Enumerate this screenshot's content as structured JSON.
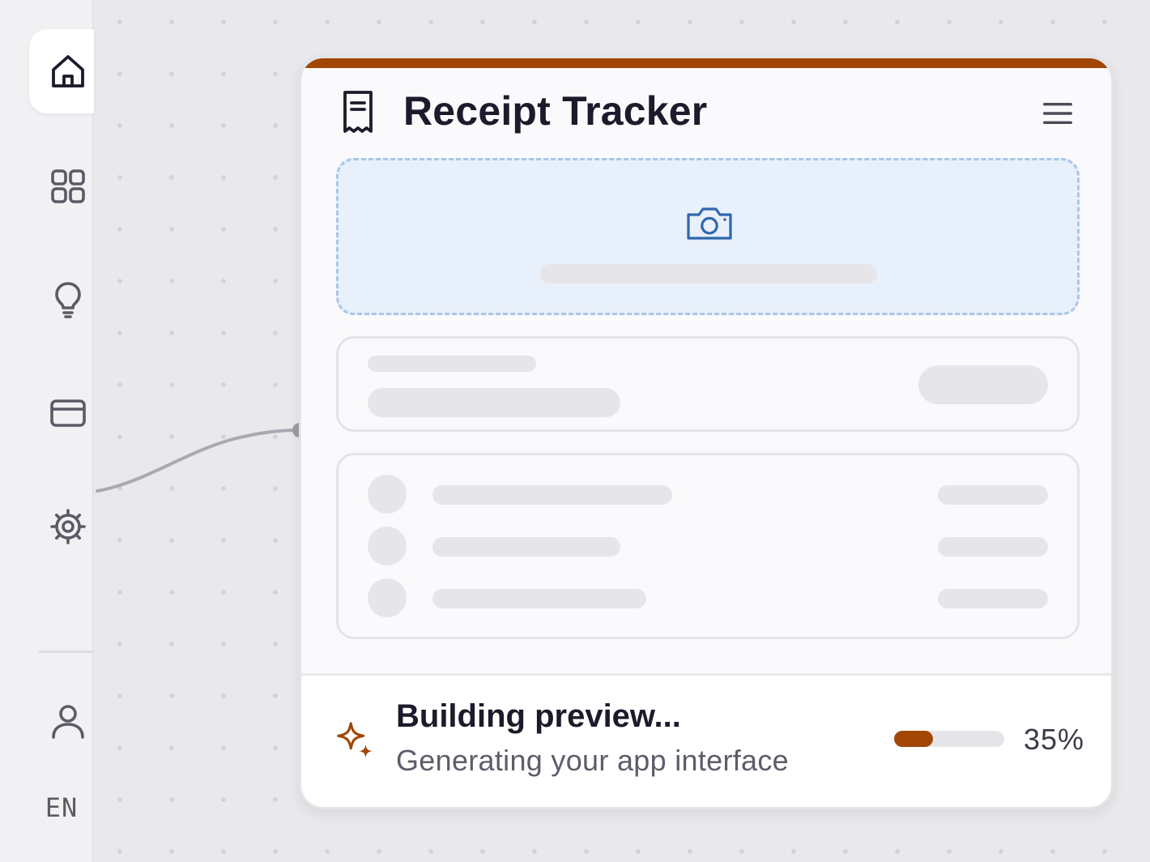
{
  "sidebar": {
    "items": [
      {
        "icon": "home-icon",
        "active": true
      },
      {
        "icon": "grid-icon",
        "active": false
      },
      {
        "icon": "lightbulb-icon",
        "active": false
      },
      {
        "icon": "credit-card-icon",
        "active": false
      },
      {
        "icon": "gear-icon",
        "active": false
      }
    ],
    "profile_icon": "user-icon",
    "language": "EN"
  },
  "preview": {
    "app_title": "Receipt Tracker",
    "header_icon": "receipt-icon",
    "menu_icon": "hamburger-menu-icon",
    "upload_icon": "camera-icon",
    "status": {
      "title": "Building preview...",
      "subtitle": "Generating your app interface",
      "progress": 0.35,
      "progress_label": "35%",
      "icon": "sparkle-icon"
    }
  },
  "colors": {
    "accent": "#a14604",
    "upload_bg": "#e8f0fb",
    "upload_border": "#a9c6e8",
    "camera": "#2f67ad",
    "skeleton": "#e6e6ea"
  }
}
